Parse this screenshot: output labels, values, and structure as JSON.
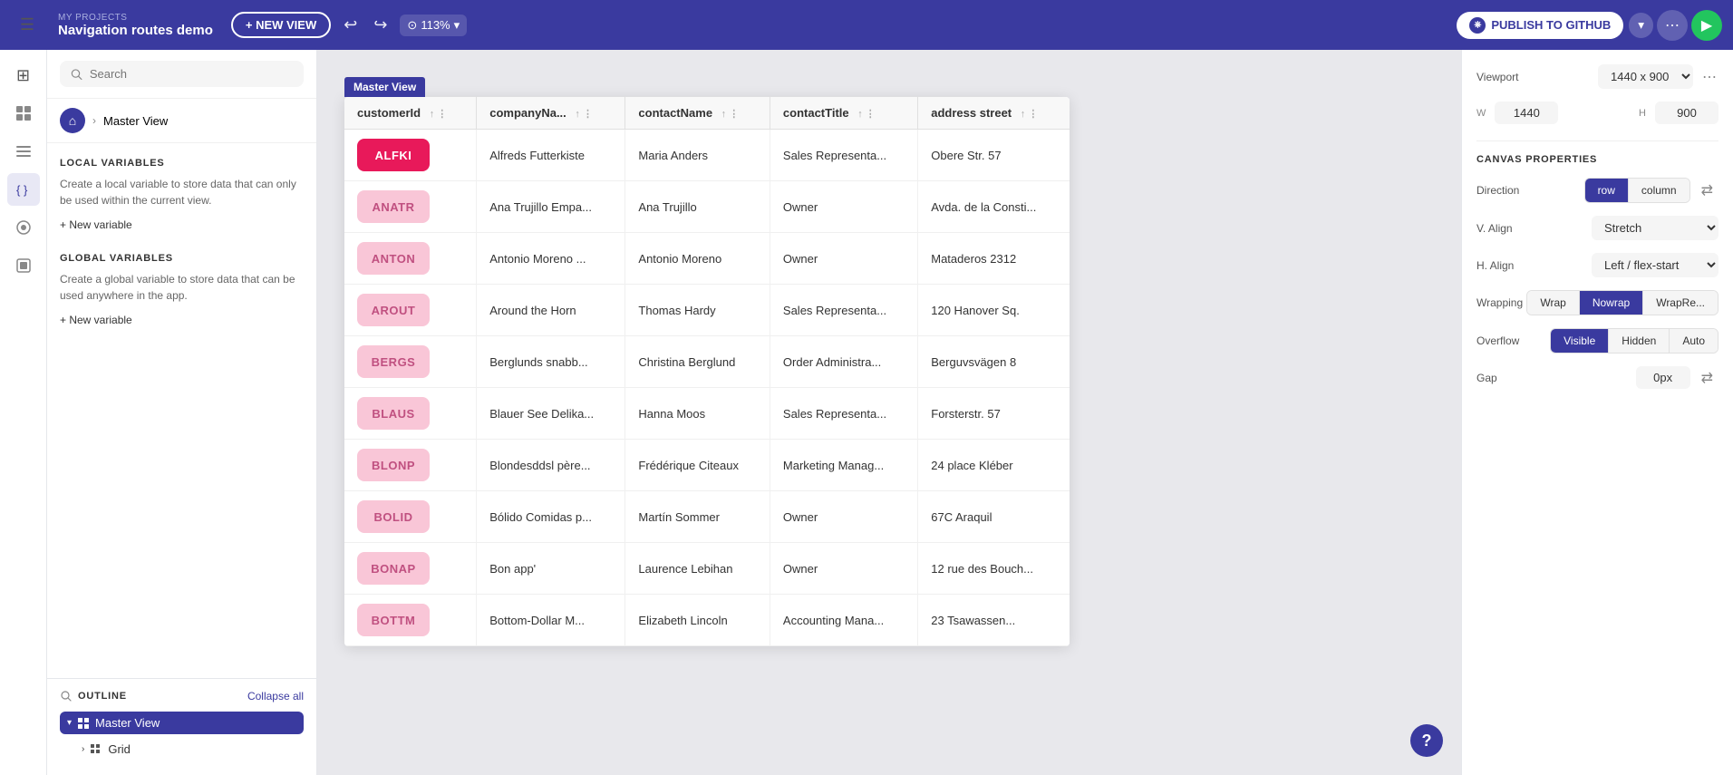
{
  "topbar": {
    "menu_icon": "☰",
    "project_label": "MY PROJECTS",
    "project_name": "Navigation routes demo",
    "new_view_label": "+ NEW VIEW",
    "undo_icon": "↩",
    "redo_icon": "↪",
    "zoom_icon": "⊙",
    "zoom_value": "113%",
    "zoom_dropdown": "▾",
    "publish_label": "PUBLISH TO GITHUB",
    "github_icon": "⎈",
    "share_icon": "⋯",
    "play_icon": "▶"
  },
  "left_sidebar": {
    "icons": [
      {
        "name": "layers-icon",
        "symbol": "⊞",
        "active": false
      },
      {
        "name": "components-icon",
        "symbol": "⊡",
        "active": false
      },
      {
        "name": "data-icon",
        "symbol": "☰",
        "active": false
      },
      {
        "name": "variables-icon",
        "symbol": "⟨⟩",
        "active": true
      },
      {
        "name": "plugins-icon",
        "symbol": "✦",
        "active": false
      },
      {
        "name": "assets-icon",
        "symbol": "⊟",
        "active": false
      }
    ]
  },
  "vars_panel": {
    "search_placeholder": "Search",
    "master_view_label": "Master View",
    "local_variables_title": "LOCAL VARIABLES",
    "local_variables_desc": "Create a local variable to store data that can only be used within the current view.",
    "local_new_variable": "+ New variable",
    "global_variables_title": "GLOBAL VARIABLES",
    "global_variables_desc": "Create a global variable to store data that can be used anywhere in the app.",
    "global_new_variable": "+ New variable",
    "outline_title": "OUTLINE",
    "collapse_all": "Collapse all",
    "outline_master_view": "Master View",
    "outline_grid": "Grid"
  },
  "canvas": {
    "frame_label": "Master View",
    "table": {
      "columns": [
        {
          "key": "customerId",
          "label": "customerId"
        },
        {
          "key": "companyNa",
          "label": "companyNa..."
        },
        {
          "key": "contactName",
          "label": "contactName"
        },
        {
          "key": "contactTitle",
          "label": "contactTitle"
        },
        {
          "key": "addressStreet",
          "label": "address street"
        }
      ],
      "rows": [
        {
          "customerId": "ALFKI",
          "hot": true,
          "companyName": "Alfreds Futterkiste",
          "contactName": "Maria Anders",
          "contactTitle": "Sales Representa...",
          "addressStreet": "Obere Str. 57"
        },
        {
          "customerId": "ANATR",
          "hot": false,
          "companyName": "Ana Trujillo Empa...",
          "contactName": "Ana Trujillo",
          "contactTitle": "Owner",
          "addressStreet": "Avda. de la Consti..."
        },
        {
          "customerId": "ANTON",
          "hot": false,
          "companyName": "Antonio Moreno ...",
          "contactName": "Antonio Moreno",
          "contactTitle": "Owner",
          "addressStreet": "Mataderos 2312"
        },
        {
          "customerId": "AROUT",
          "hot": false,
          "companyName": "Around the Horn",
          "contactName": "Thomas Hardy",
          "contactTitle": "Sales Representa...",
          "addressStreet": "120 Hanover Sq."
        },
        {
          "customerId": "BERGS",
          "hot": false,
          "companyName": "Berglunds snabb...",
          "contactName": "Christina Berglund",
          "contactTitle": "Order Administra...",
          "addressStreet": "Berguvsvägen 8"
        },
        {
          "customerId": "BLAUS",
          "hot": false,
          "companyName": "Blauer See Delika...",
          "contactName": "Hanna Moos",
          "contactTitle": "Sales Representa...",
          "addressStreet": "Forsterstr. 57"
        },
        {
          "customerId": "BLONP",
          "hot": false,
          "companyName": "Blondesddsl père...",
          "contactName": "Frédérique Citeaux",
          "contactTitle": "Marketing Manag...",
          "addressStreet": "24 place Kléber"
        },
        {
          "customerId": "BOLID",
          "hot": false,
          "companyName": "Bólido Comidas p...",
          "contactName": "Martín Sommer",
          "contactTitle": "Owner",
          "addressStreet": "67C Araquil"
        },
        {
          "customerId": "BONAP",
          "hot": false,
          "companyName": "Bon app'",
          "contactName": "Laurence Lebihan",
          "contactTitle": "Owner",
          "addressStreet": "12 rue des Bouch..."
        },
        {
          "customerId": "BOTTM",
          "hot": false,
          "companyName": "Bottom-Dollar M...",
          "contactName": "Elizabeth Lincoln",
          "contactTitle": "Accounting Mana...",
          "addressStreet": "23 Tsawassen..."
        }
      ]
    }
  },
  "right_panel": {
    "canvas_properties_title": "CANVAS PROPERTIES",
    "viewport_label": "Viewport",
    "viewport_value": "1440 x 900",
    "w_label": "W",
    "w_value": "1440",
    "h_label": "H",
    "h_value": "900",
    "direction_label": "Direction",
    "row_label": "row",
    "column_label": "column",
    "valign_label": "V. Align",
    "valign_value": "Stretch",
    "halign_label": "H. Align",
    "halign_value": "Left / flex-start",
    "wrapping_label": "Wrapping",
    "wrap_label": "Wrap",
    "nowrap_label": "Nowrap",
    "wrapre_label": "WrapRe...",
    "overflow_label": "Overflow",
    "visible_label": "Visible",
    "hidden_label": "Hidden",
    "auto_label": "Auto",
    "gap_label": "Gap",
    "gap_value": "0px",
    "swap_icon": "⇄"
  }
}
